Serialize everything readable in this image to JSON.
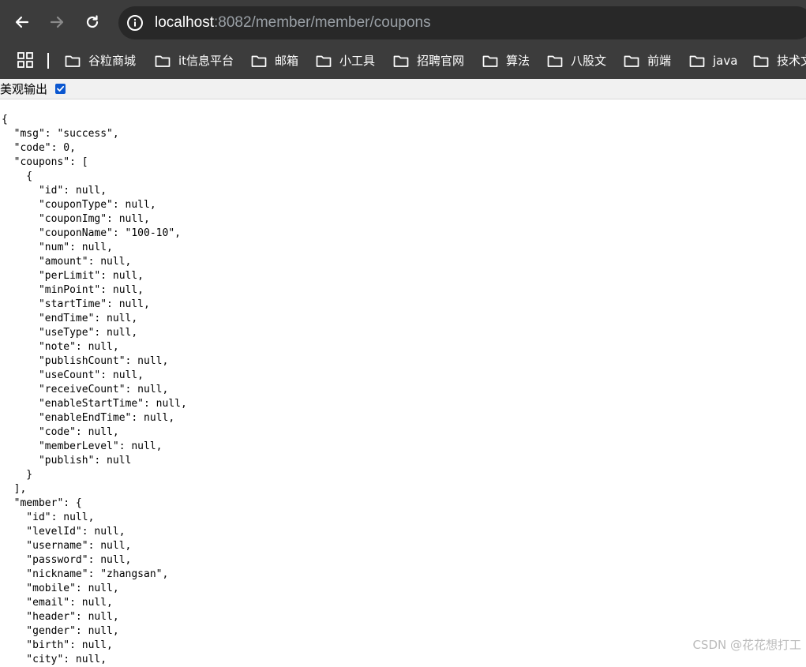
{
  "browser": {
    "url_host": "localhost",
    "url_rest": ":8082/member/member/coupons",
    "bookmarks": [
      "谷粒商城",
      "it信息平台",
      "邮箱",
      "小工具",
      "招聘官网",
      "算法",
      "八股文",
      "前端",
      "java",
      "技术文"
    ]
  },
  "pretty_print": {
    "label": "美观输出",
    "checked": true
  },
  "json_lines": [
    "{",
    "  \"msg\": \"success\",",
    "  \"code\": 0,",
    "  \"coupons\": [",
    "    {",
    "      \"id\": null,",
    "      \"couponType\": null,",
    "      \"couponImg\": null,",
    "      \"couponName\": \"100-10\",",
    "      \"num\": null,",
    "      \"amount\": null,",
    "      \"perLimit\": null,",
    "      \"minPoint\": null,",
    "      \"startTime\": null,",
    "      \"endTime\": null,",
    "      \"useType\": null,",
    "      \"note\": null,",
    "      \"publishCount\": null,",
    "      \"useCount\": null,",
    "      \"receiveCount\": null,",
    "      \"enableStartTime\": null,",
    "      \"enableEndTime\": null,",
    "      \"code\": null,",
    "      \"memberLevel\": null,",
    "      \"publish\": null",
    "    }",
    "  ],",
    "  \"member\": {",
    "    \"id\": null,",
    "    \"levelId\": null,",
    "    \"username\": null,",
    "    \"password\": null,",
    "    \"nickname\": \"zhangsan\",",
    "    \"mobile\": null,",
    "    \"email\": null,",
    "    \"header\": null,",
    "    \"gender\": null,",
    "    \"birth\": null,",
    "    \"city\": null,"
  ],
  "watermark": "CSDN @花花想打工"
}
